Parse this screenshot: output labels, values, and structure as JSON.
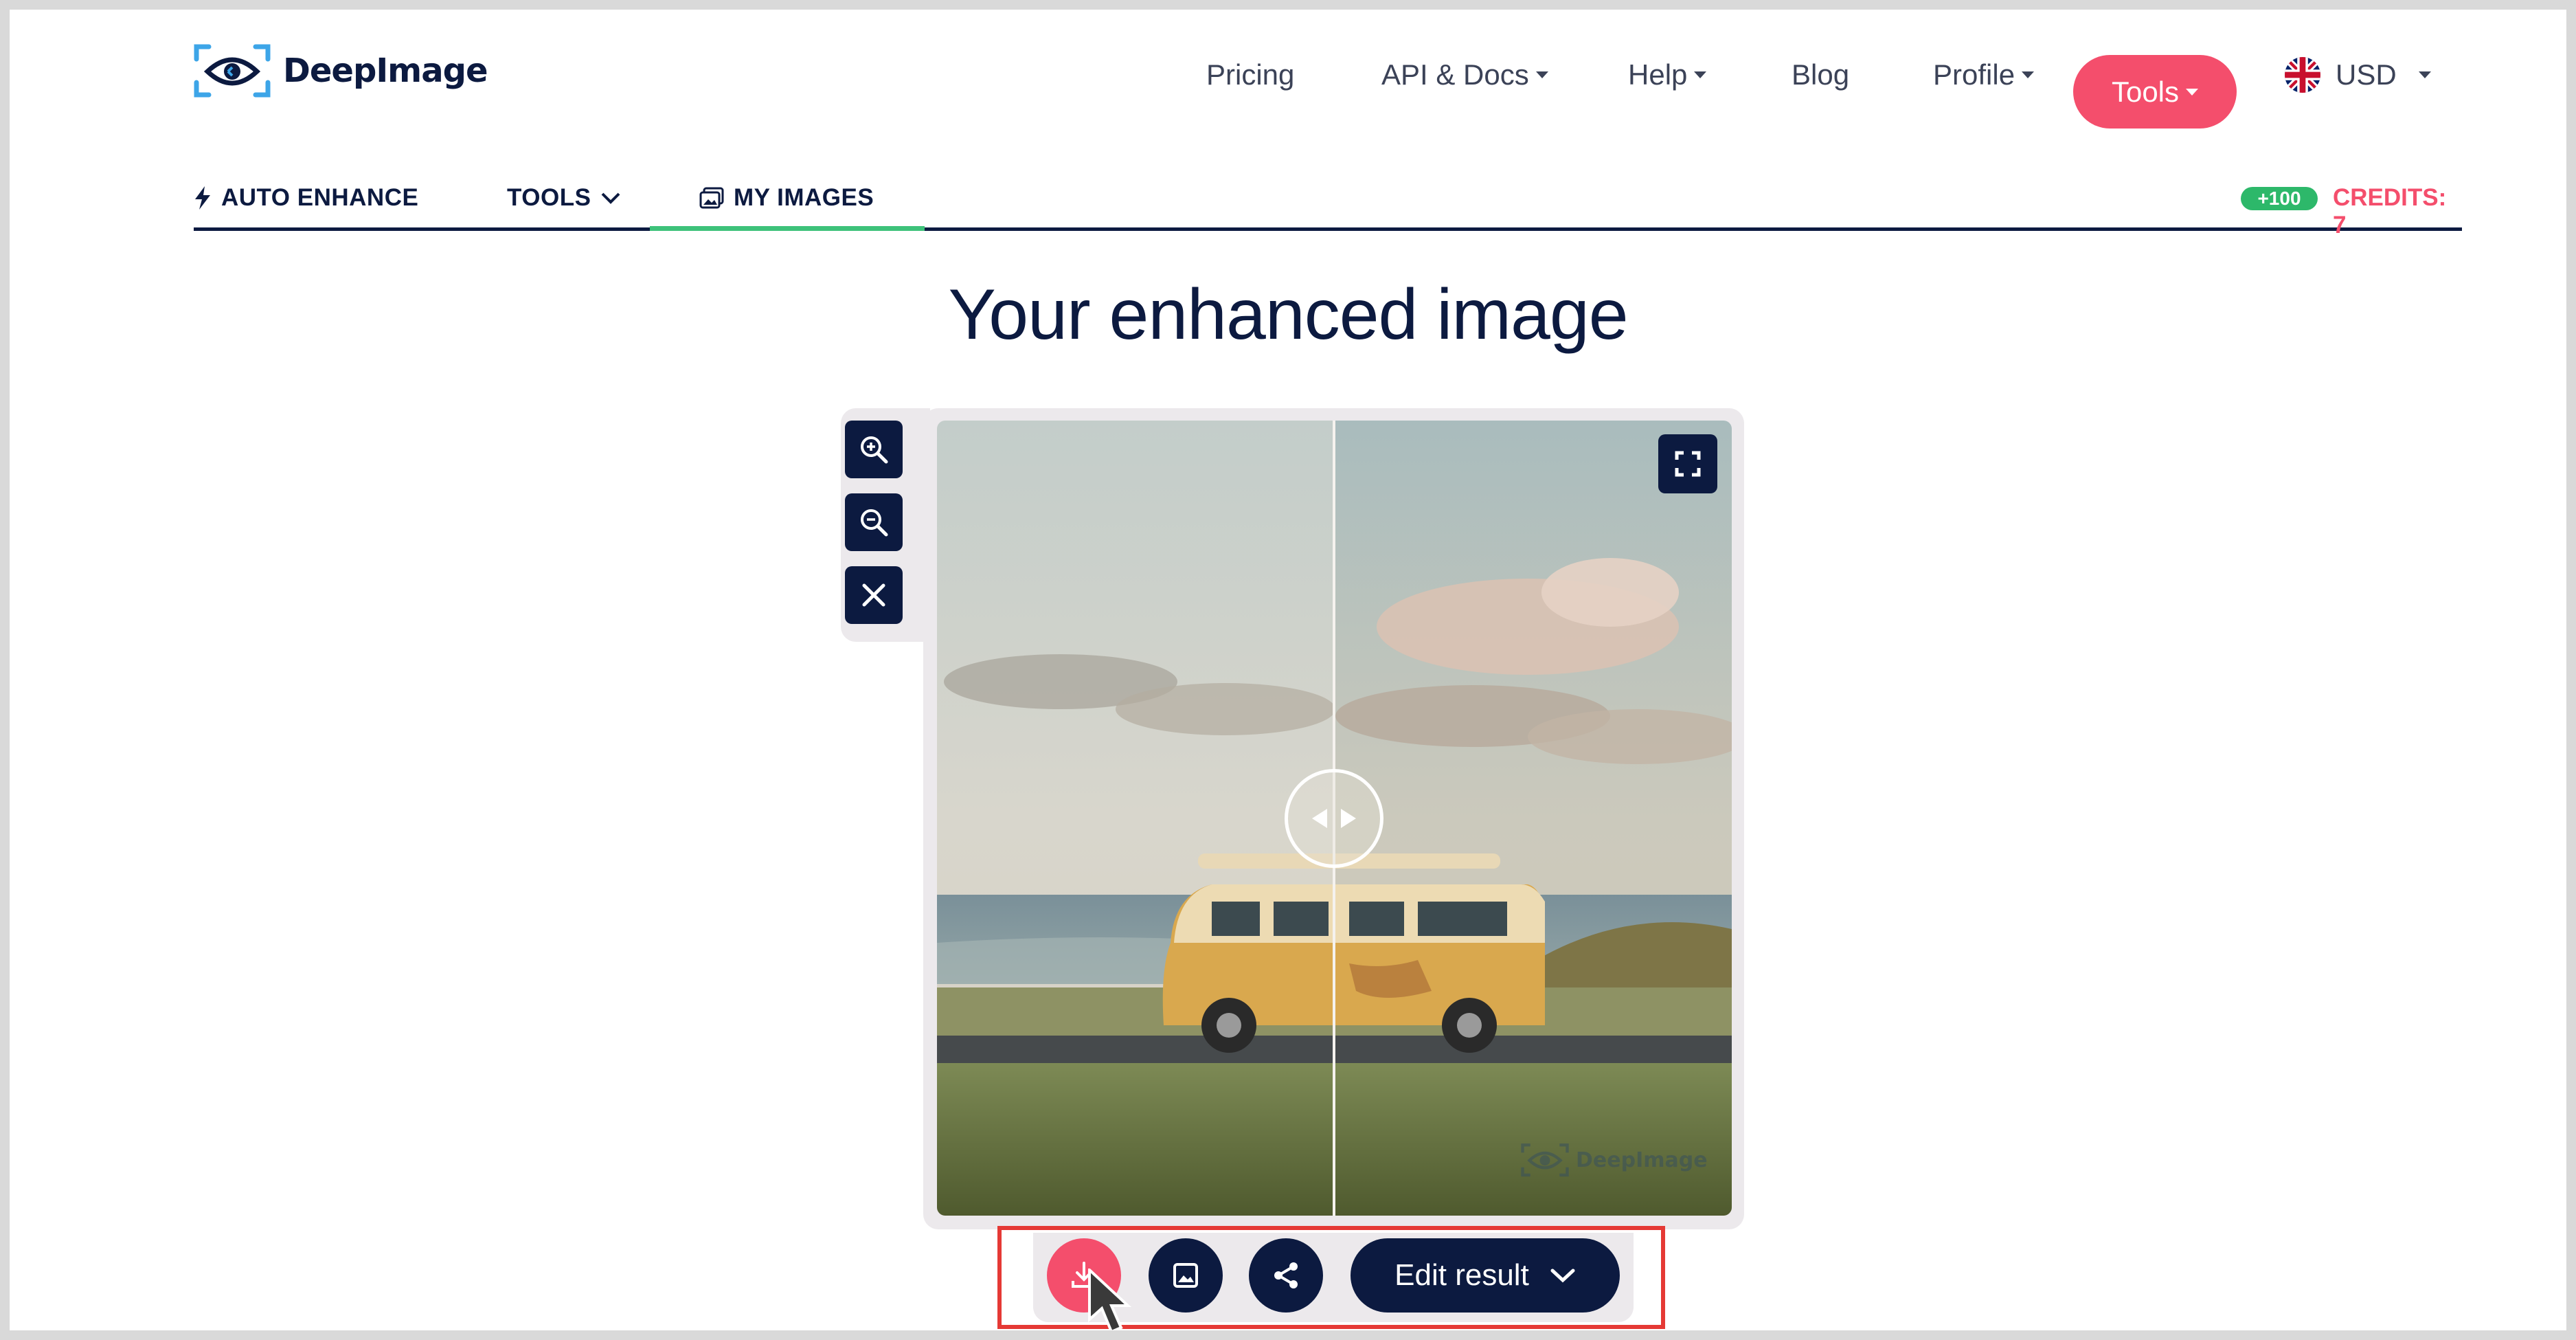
{
  "brand": {
    "name": "DeepImage"
  },
  "nav": {
    "pricing": "Pricing",
    "api_docs": "API & Docs",
    "help": "Help",
    "blog": "Blog",
    "profile": "Profile",
    "tools": "Tools",
    "currency": "USD"
  },
  "tabs": {
    "auto_enhance": "AUTO ENHANCE",
    "tools": "TOOLS",
    "my_images": "MY IMAGES",
    "active": "MY IMAGES"
  },
  "credits": {
    "bonus_badge": "+100",
    "label": "CREDITS: 7"
  },
  "main": {
    "title": "Your enhanced image",
    "watermark": "DeepImage"
  },
  "actions": {
    "edit_result": "Edit result"
  },
  "colors": {
    "primary_navy": "#0c1a40",
    "accent_pink": "#f44e6c",
    "active_tab_green": "#3ec27a",
    "badge_green": "#2db86a",
    "highlight_red": "#e53935"
  },
  "icons": {
    "logo": "eye-logo-icon",
    "zoom_in": "zoom-in-icon",
    "zoom_out": "zoom-out-icon",
    "close": "close-icon",
    "fullscreen": "fullscreen-icon",
    "slider": "compare-slider-icon",
    "download": "download-icon",
    "image": "image-icon",
    "share": "share-icon",
    "chevron": "chevron-down-icon"
  }
}
